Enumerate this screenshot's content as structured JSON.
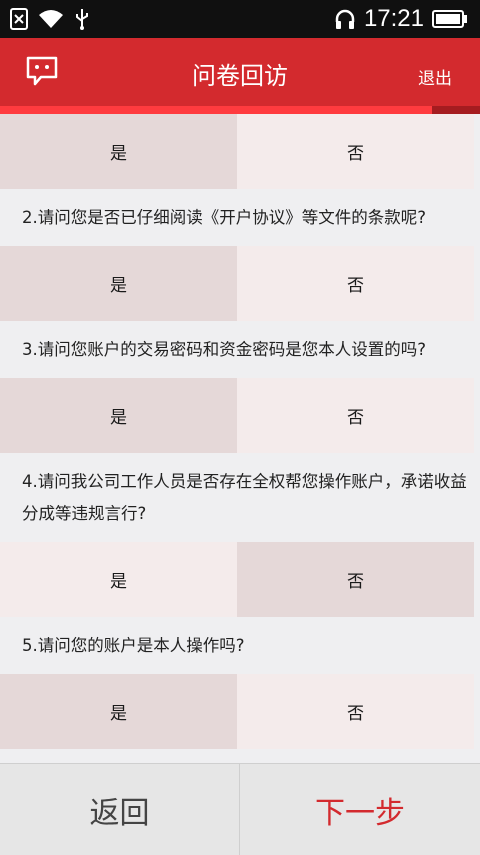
{
  "status_bar": {
    "time": "17:21",
    "icons": [
      "sim-icon",
      "wifi-icon",
      "usb-icon",
      "headphone-icon",
      "battery-icon"
    ]
  },
  "header": {
    "title": "问卷回访",
    "logout_label": "退出",
    "message_icon": "message-icon",
    "bg_color": "#d32a2e"
  },
  "progress": {
    "fraction": 0.9
  },
  "questions": [
    {
      "text": "",
      "yes_label": "是",
      "no_label": "否",
      "selected": "yes"
    },
    {
      "text": "2.请问您是否已仔细阅读《开户协议》等文件的条款呢?",
      "yes_label": "是",
      "no_label": "否",
      "selected": "yes"
    },
    {
      "text": "3.请问您账户的交易密码和资金密码是您本人设置的吗?",
      "yes_label": "是",
      "no_label": "否",
      "selected": "yes"
    },
    {
      "text": "4.请问我公司工作人员是否存在全权帮您操作账户，承诺收益分成等违规言行?",
      "yes_label": "是",
      "no_label": "否",
      "selected": "no"
    },
    {
      "text": "5.请问您的账户是本人操作吗?",
      "yes_label": "是",
      "no_label": "否",
      "selected": "yes"
    }
  ],
  "footer": {
    "back_label": "返回",
    "next_label": "下一步"
  }
}
